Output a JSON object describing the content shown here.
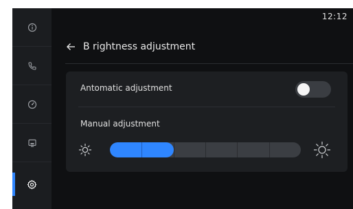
{
  "status_bar": {
    "time": "12:12"
  },
  "sidebar": {
    "items": [
      {
        "name": "info",
        "icon": "info-circle-icon"
      },
      {
        "name": "phone",
        "icon": "phone-icon"
      },
      {
        "name": "dashboard",
        "icon": "gauge-icon"
      },
      {
        "name": "display",
        "icon": "screen-icon"
      },
      {
        "name": "settings",
        "icon": "gear-icon",
        "active": true
      }
    ]
  },
  "header": {
    "title": "B rightness adjustment",
    "back_icon": "arrow-left-icon"
  },
  "settings": {
    "automatic": {
      "label": "Antomatic adjustment",
      "enabled": false
    },
    "manual": {
      "label": "Manual adjustment",
      "min_icon": "sun-small-icon",
      "max_icon": "sun-large-icon",
      "segments": 6,
      "level": 2
    }
  },
  "colors": {
    "accent": "#2f86ff",
    "track": "#3b3e43",
    "card": "#1d1f22",
    "background": "#0f1012"
  }
}
